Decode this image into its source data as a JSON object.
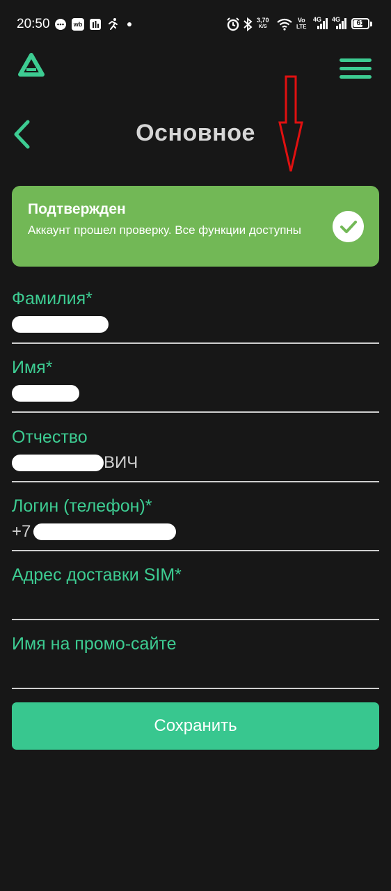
{
  "status_bar": {
    "time": "20:50",
    "network_speed_value": "3,70",
    "network_speed_unit": "K/S",
    "volte_top": "Vo",
    "volte_bottom": "LTE",
    "sim1_label": "4G",
    "sim2_label": "4G",
    "battery_level": "61",
    "icons": [
      "message-icon",
      "wb-app-icon",
      "docs-app-icon",
      "running-icon",
      "notification-dot-icon",
      "alarm-icon",
      "bluetooth-icon",
      "wifi-icon",
      "signal-icon",
      "battery-icon"
    ]
  },
  "header": {
    "page_title": "Основное",
    "logo_icon": "triangle-logo-icon",
    "menu_icon": "hamburger-menu-icon",
    "back_icon": "chevron-left-icon"
  },
  "verified": {
    "title": "Подтвержден",
    "text": "Аккаунт прошел проверку. Все функции доступны",
    "color": "#72b856"
  },
  "fields": {
    "surname": {
      "label": "Фамилия*",
      "value": ""
    },
    "name": {
      "label": "Имя*",
      "value": ""
    },
    "patronymic": {
      "label": "Отчество",
      "value_suffix": "ВИЧ"
    },
    "login": {
      "label": "Логин (телефон)*",
      "value_prefix": "+7"
    },
    "address": {
      "label": "Адрес доставки SIM*",
      "value": ""
    },
    "promo_name": {
      "label": "Имя на промо-сайте",
      "value": ""
    }
  },
  "save_button": {
    "label": "Сохранить",
    "color": "#38c78f"
  },
  "colors": {
    "background": "#171717",
    "accent": "#3dcc92",
    "annotation_arrow": "#e01010"
  }
}
